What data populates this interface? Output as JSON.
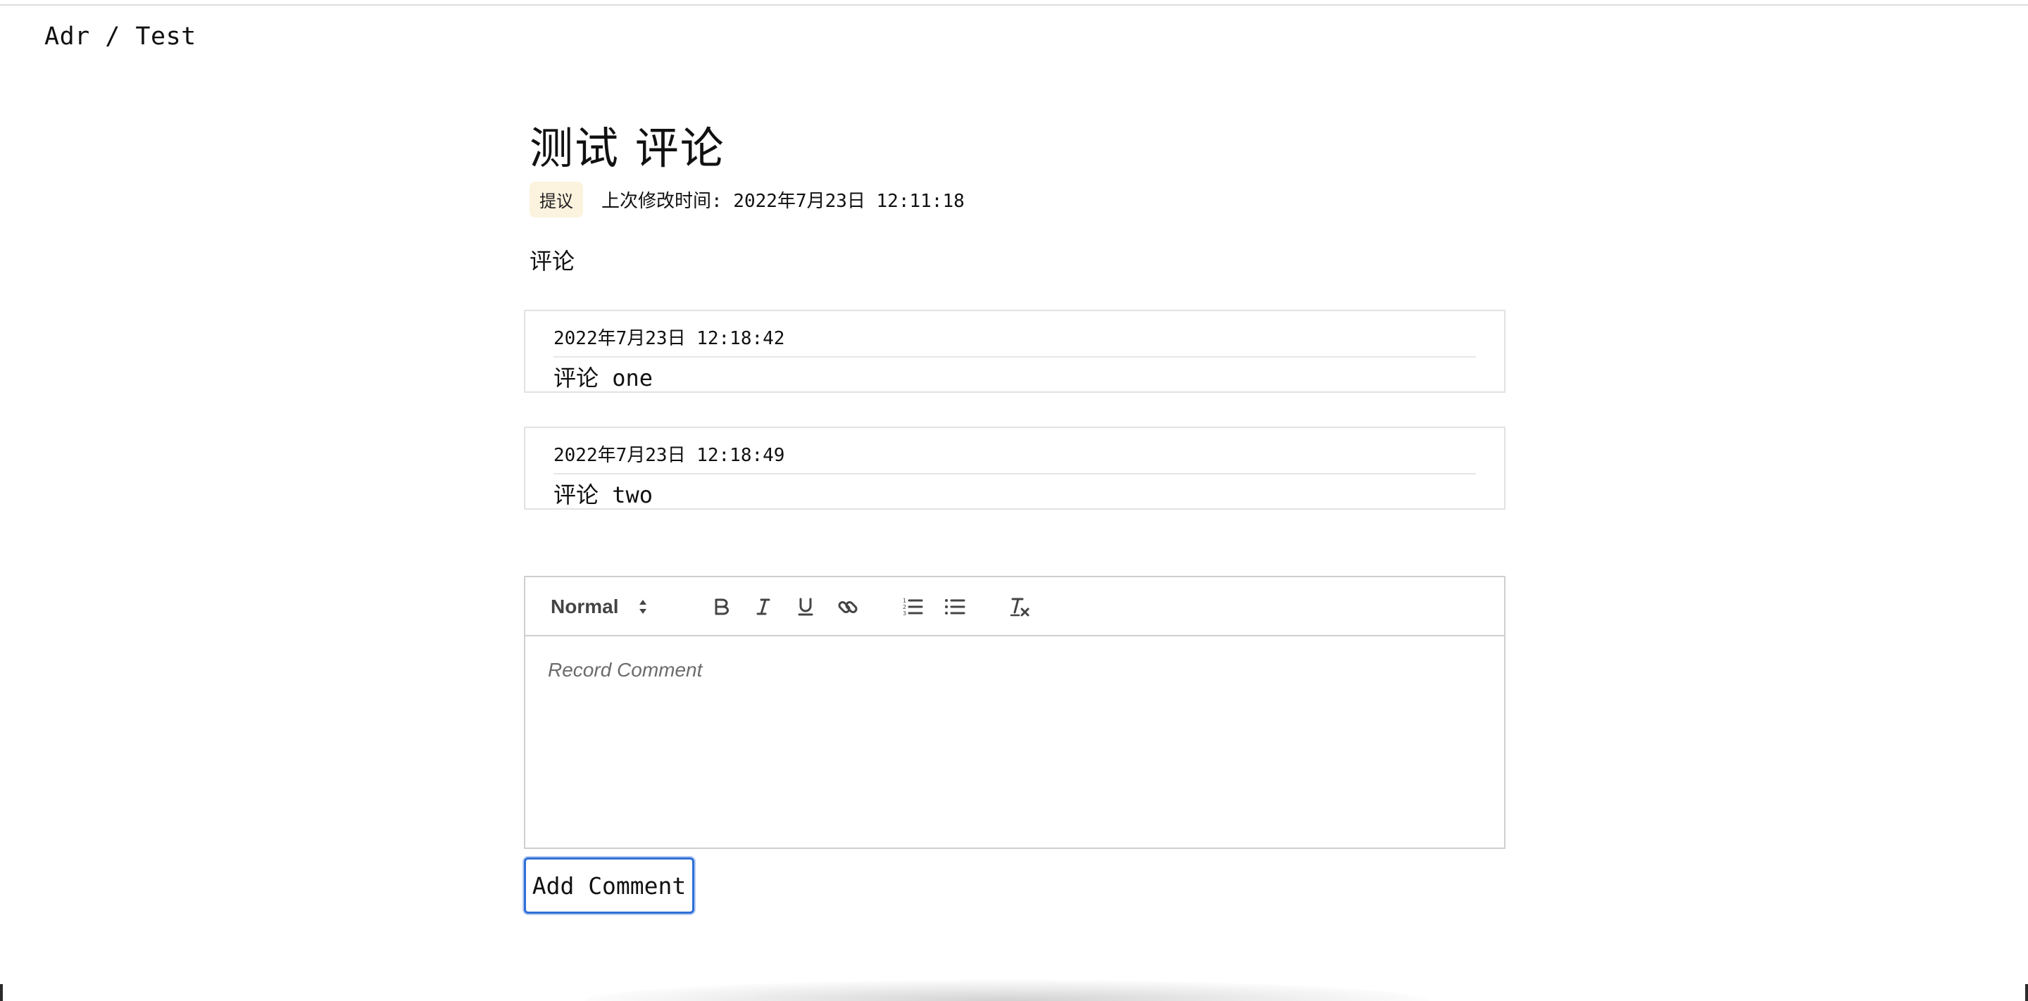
{
  "breadcrumb": "Adr / Test",
  "record": {
    "title": "测试 评论",
    "status_badge": "提议",
    "modified_text": "上次修改时间: 2022年7月23日 12:11:18"
  },
  "comments_section": {
    "label": "评论",
    "items": [
      {
        "timestamp": "2022年7月23日 12:18:42",
        "text": "评论 one"
      },
      {
        "timestamp": "2022年7月23日 12:18:49",
        "text": "评论 two"
      }
    ]
  },
  "editor": {
    "format_select": "Normal",
    "toolbar_icons": [
      "bold-icon",
      "italic-icon",
      "underline-icon",
      "link-icon",
      "ordered-list-icon",
      "bullet-list-icon",
      "clear-format-icon"
    ],
    "placeholder": "Record Comment"
  },
  "add_comment_button": "Add Comment",
  "colors": {
    "badge_bg": "#fbf3de",
    "button_focus": "#2f6fd6",
    "toolbar_icon": "#444444"
  }
}
